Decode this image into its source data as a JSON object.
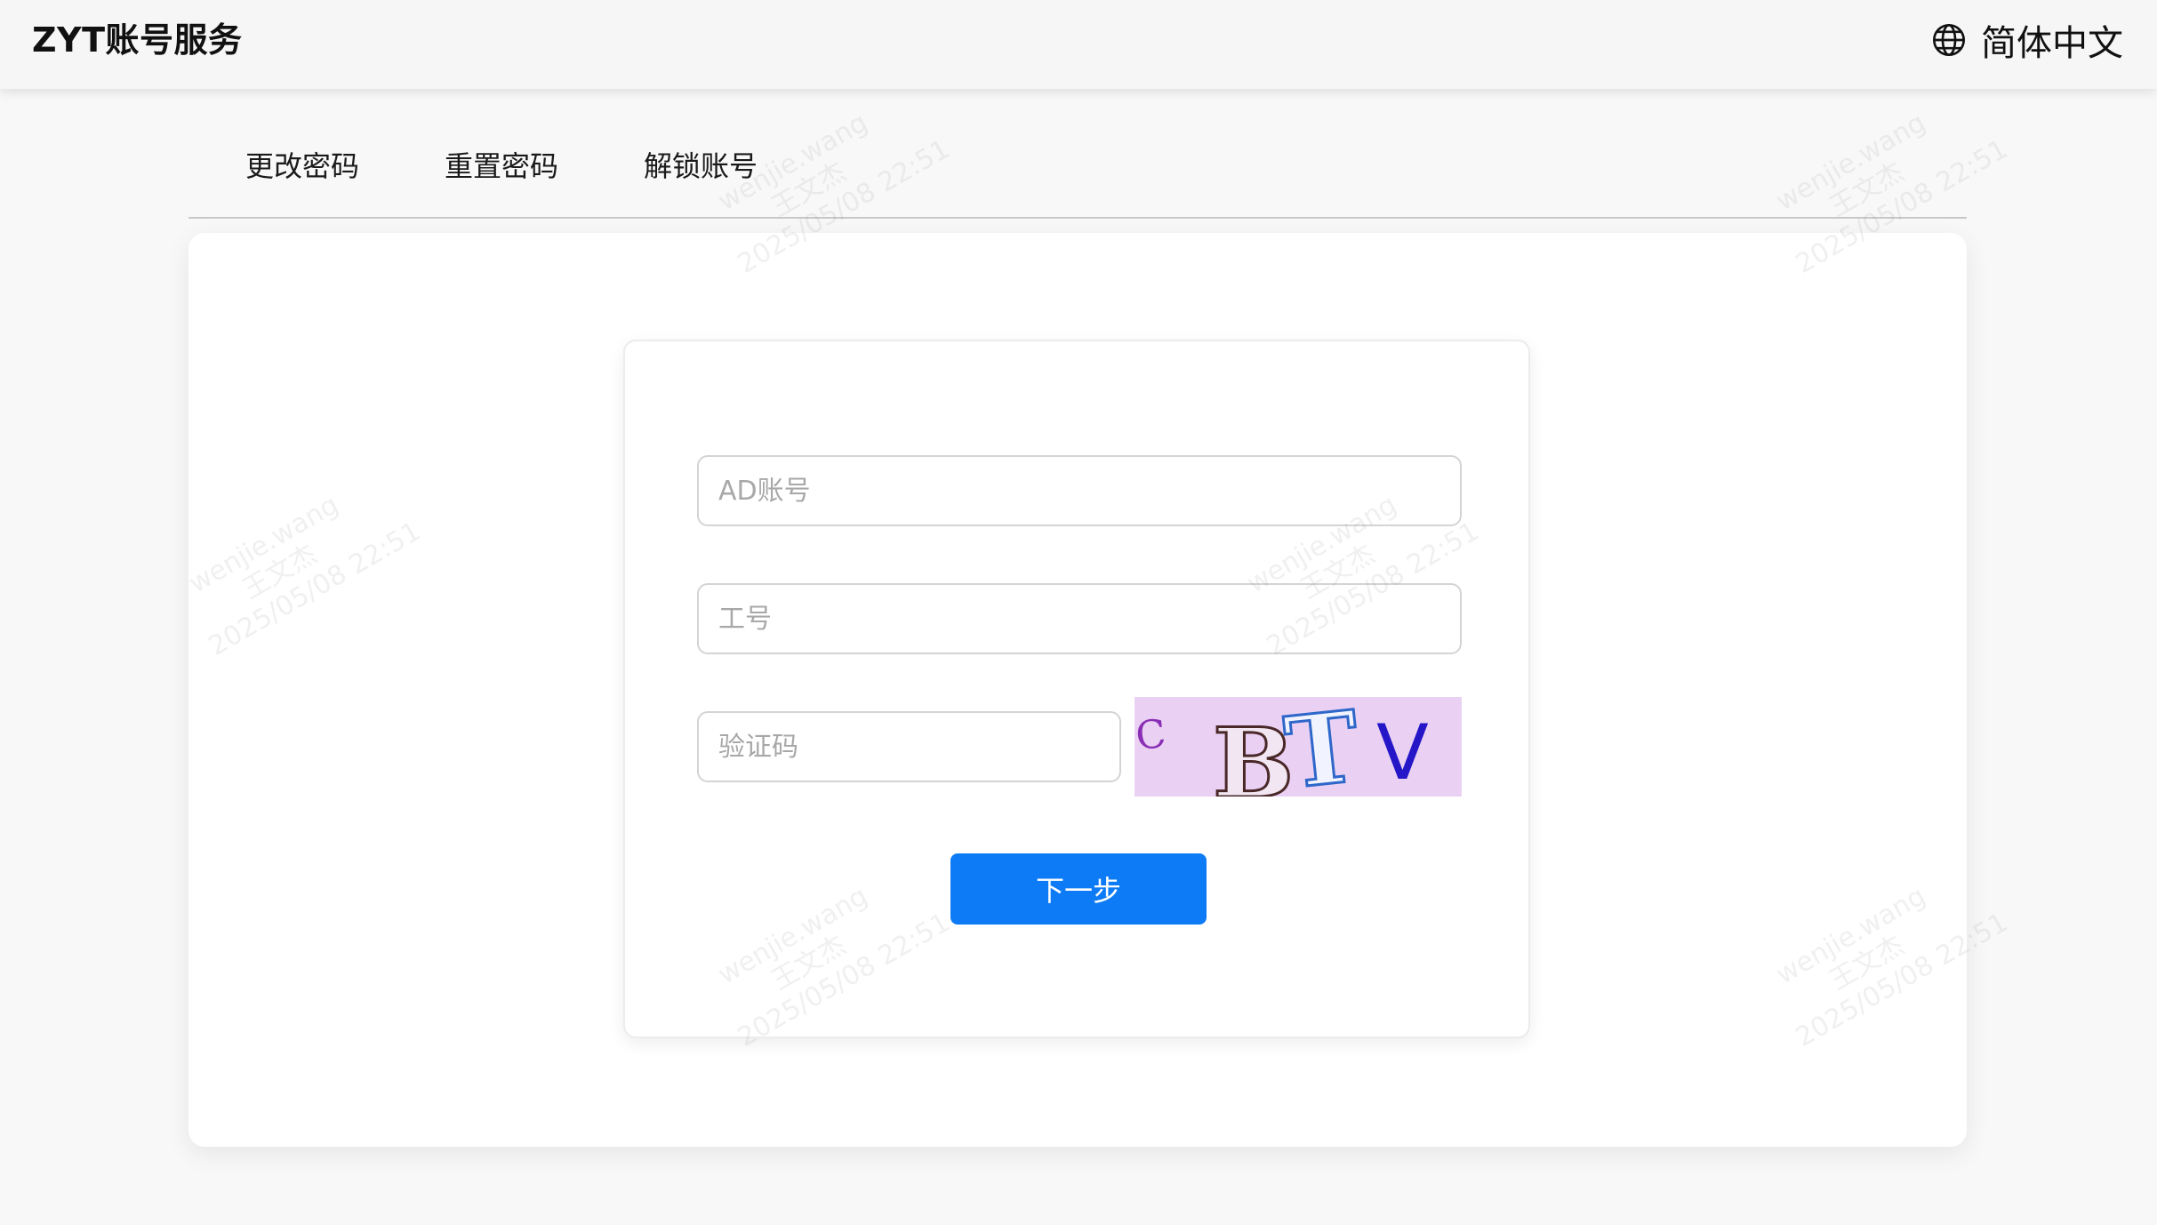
{
  "header": {
    "app_title": "ZYT账号服务",
    "language_label": "简体中文",
    "language_icon": "globe-icon"
  },
  "tabs": [
    {
      "label": "更改密码"
    },
    {
      "label": "重置密码"
    },
    {
      "label": "解锁账号"
    }
  ],
  "form": {
    "account_placeholder": "AD账号",
    "account_value": "",
    "employee_no_placeholder": "工号",
    "employee_no_value": "",
    "captcha_placeholder": "验证码",
    "captcha_value": "",
    "captcha_image_text": "C BTV",
    "next_button": "下一步",
    "primary_color": "#0d7bf5"
  },
  "watermark": {
    "user": "wenjie.wang",
    "name": "王文杰",
    "timestamp": "2025/05/08 22:51"
  }
}
